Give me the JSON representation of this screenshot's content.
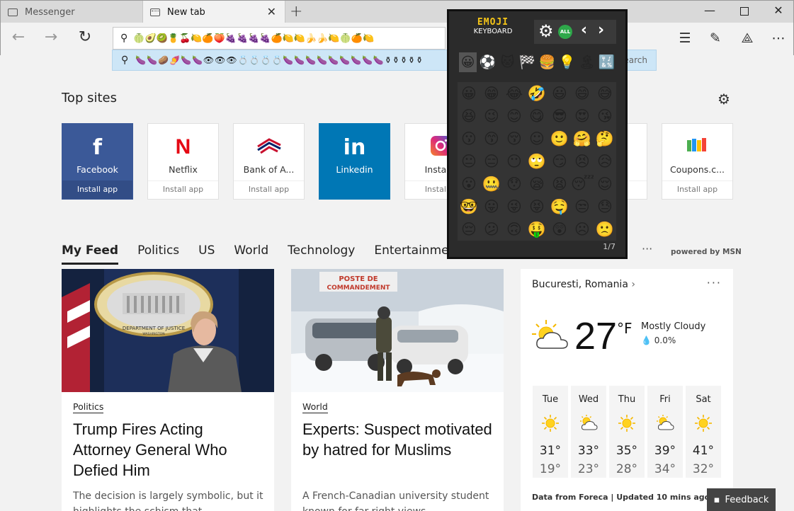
{
  "browser": {
    "tabs": [
      {
        "label": "Messenger",
        "active": false
      },
      {
        "label": "New tab",
        "active": true
      }
    ],
    "window_controls": [
      "minimize",
      "maximize",
      "close"
    ],
    "address_value": "🍈🥑🥝🍍🍒🍋🍊🍑🍇🍇🍇🍇🍊🍋🍋🍌🍌🍋🍈🍊🍋",
    "suggestion_value": "🍆🍆🥔🍠🍆🍆👁👁👁💍💍💍💍🍆🍆🍆🍆🍆🍆🍆🍆🍆⚱⚱⚱⚱⚱",
    "suggestion_action": "search"
  },
  "topsites": {
    "title": "Top sites",
    "tiles": [
      {
        "name": "Facebook",
        "install": "Install app",
        "logo": "f"
      },
      {
        "name": "Netflix",
        "install": "Install app",
        "logo": "N"
      },
      {
        "name": "Bank of A...",
        "install": "Install app",
        "logo": "flag"
      },
      {
        "name": "Linkedin",
        "install": "",
        "logo": "in"
      },
      {
        "name": "Instagr",
        "install": "Install a",
        "logo": "ig"
      },
      {
        "name": "",
        "install": "p",
        "logo": ""
      },
      {
        "name": "Coupons.c...",
        "install": "Install app",
        "logo": "bars"
      }
    ]
  },
  "feed": {
    "tabs": [
      "My Feed",
      "Politics",
      "US",
      "World",
      "Technology",
      "Entertainment"
    ],
    "more": "···",
    "powered_by": "powered by MSN",
    "cards": [
      {
        "category": "Politics",
        "headline": "Trump Fires Acting Attorney General Who Defied Him",
        "snippet": "The decision is largely symbolic, but it highlights the schism that"
      },
      {
        "category": "World",
        "headline": "Experts: Suspect motivated by hatred for Muslims",
        "snippet": "A French-Canadian university student known for far-right views"
      }
    ],
    "photo_texts": {
      "seal_top": "DEPARTMENT OF JUSTICE",
      "seal_bottom": "WASHINGTON",
      "sign_line1": "POSTE DE",
      "sign_line2": "COMMANDEMENT"
    }
  },
  "weather": {
    "location": "Bucuresti, Romania",
    "more": "···",
    "temp": "27",
    "unit": "°F",
    "condition": "Mostly Cloudy",
    "precip": "0.0%",
    "forecast": [
      {
        "day": "Tue",
        "hi": "31°",
        "lo": "19°",
        "icon": "sun"
      },
      {
        "day": "Wed",
        "hi": "33°",
        "lo": "23°",
        "icon": "partly-cloudy"
      },
      {
        "day": "Thu",
        "hi": "35°",
        "lo": "28°",
        "icon": "sun"
      },
      {
        "day": "Fri",
        "hi": "39°",
        "lo": "34°",
        "icon": "partly-cloudy"
      },
      {
        "day": "Sat",
        "hi": "41°",
        "lo": "32°",
        "icon": "sun"
      }
    ],
    "footer": "Data from Foreca | Updated 10 mins ago"
  },
  "feedback": "Feedback",
  "emoji_keyboard": {
    "brand_line1": "EMOJI",
    "brand_line2": "KEYBOARD",
    "all_label": "ALL",
    "categories": [
      "😀",
      "⚽",
      "🐱",
      "🏁",
      "🍔",
      "💡",
      "🏝",
      "🔣"
    ],
    "emojis": [
      "😀",
      "😁",
      "😂",
      "🤣",
      "😃",
      "😄",
      "😅",
      "😆",
      "😉",
      "😊",
      "😋",
      "😎",
      "😍",
      "😘",
      "😗",
      "😙",
      "😚",
      "☺",
      "🙂",
      "🤗",
      "🤔",
      "😐",
      "😑",
      "😶",
      "🙄",
      "😏",
      "😣",
      "😥",
      "😮",
      "🤐",
      "😯",
      "😪",
      "😫",
      "😴",
      "😌",
      "🤓",
      "😛",
      "😜",
      "😝",
      "🤤",
      "😒",
      "😓",
      "😔",
      "😕",
      "🙃",
      "🤑",
      "😲",
      "☹",
      "🙁"
    ],
    "page": "1/7"
  }
}
